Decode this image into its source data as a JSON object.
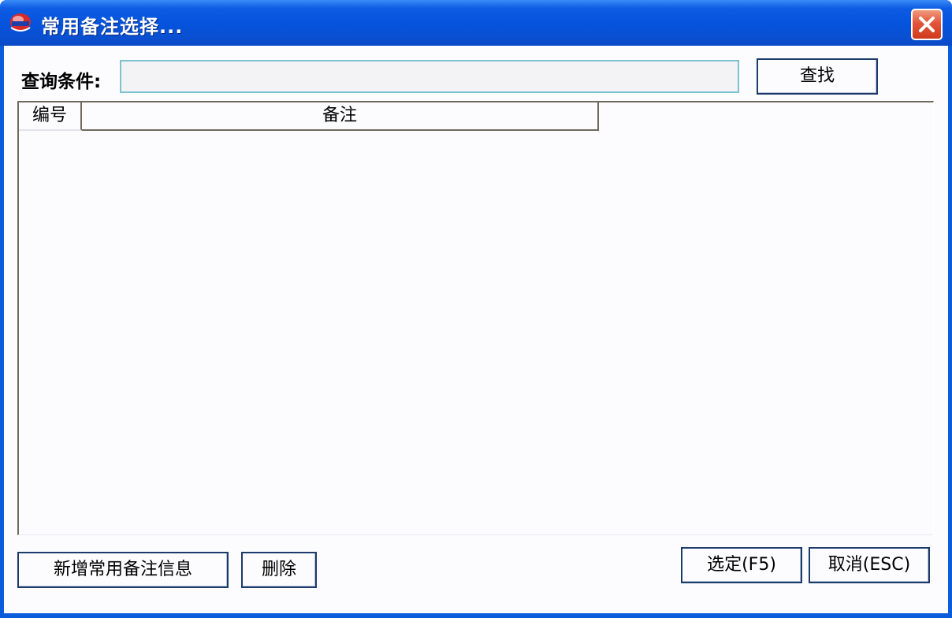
{
  "window": {
    "title": "常用备注选择...",
    "icons": {
      "app": "app-logo-icon",
      "close": "close-icon"
    },
    "colors": {
      "titlebar": "#0553dc",
      "close": "#e2553a",
      "client": "#fcfcfe"
    }
  },
  "query": {
    "label": "查询条件:",
    "value": "",
    "search_button": "查找"
  },
  "grid": {
    "columns": [
      "编号",
      "备注"
    ],
    "rows": []
  },
  "footer": {
    "add_button": "新增常用备注信息",
    "delete_button": "删除",
    "select_button": "选定(F5)",
    "cancel_button": "取消(ESC)"
  }
}
